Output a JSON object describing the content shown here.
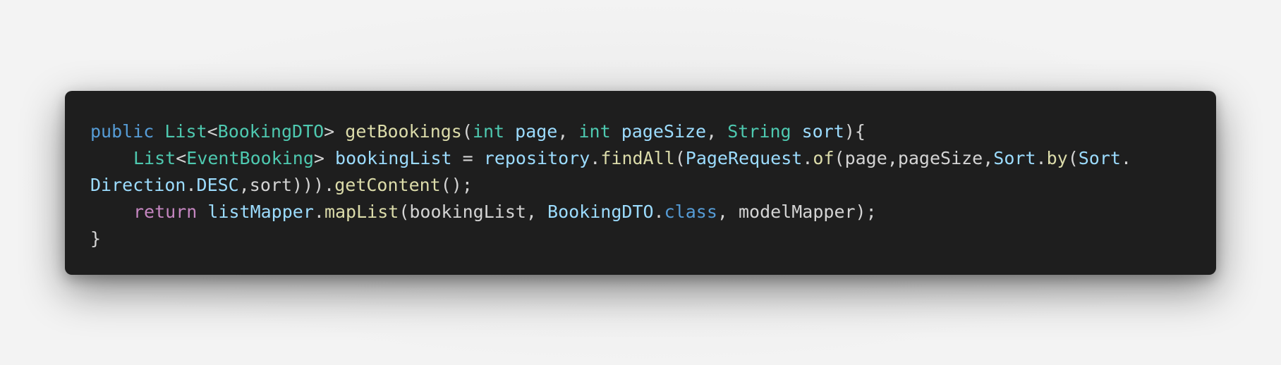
{
  "colors": {
    "background": "#f3f3f3",
    "editor_background": "#1e1e1e",
    "keyword": "#569cd6",
    "control_keyword": "#c586c0",
    "type": "#4ec9b0",
    "function": "#dcdcaa",
    "variable": "#9cdcfe",
    "default_text": "#d4d4d4"
  },
  "code": {
    "line1": {
      "t1": "public",
      "t2": " ",
      "t3": "List",
      "t4": "<",
      "t5": "BookingDTO",
      "t6": ">",
      "t7": " ",
      "t8": "getBookings",
      "t9": "(",
      "t10": "int",
      "t11": " ",
      "t12": "page",
      "t13": ", ",
      "t14": "int",
      "t15": " ",
      "t16": "pageSize",
      "t17": ", ",
      "t18": "String",
      "t19": " ",
      "t20": "sort",
      "t21": "){"
    },
    "line2": {
      "t1": "List",
      "t2": "<",
      "t3": "EventBooking",
      "t4": ">",
      "t5": " ",
      "t6": "bookingList",
      "t7": " = ",
      "t8": "repository",
      "t9": ".",
      "t10": "findAll",
      "t11": "(",
      "t12": "PageRequest",
      "t13": ".",
      "t14": "of",
      "t15": "(page,pageSize,",
      "t16": "Sort",
      "t17": ".",
      "t18": "by",
      "t19": "(",
      "t20": "Sort",
      "t21": "."
    },
    "line3": {
      "t1": "Direction",
      "t2": ".",
      "t3": "DESC",
      "t4": ",sort))).",
      "t5": "getContent",
      "t6": "();"
    },
    "line4": {
      "t1": "return",
      "t2": " ",
      "t3": "listMapper",
      "t4": ".",
      "t5": "mapList",
      "t6": "(bookingList, ",
      "t7": "BookingDTO",
      "t8": ".",
      "t9": "class",
      "t10": ", modelMapper);"
    },
    "line5": {
      "t1": "}"
    }
  }
}
